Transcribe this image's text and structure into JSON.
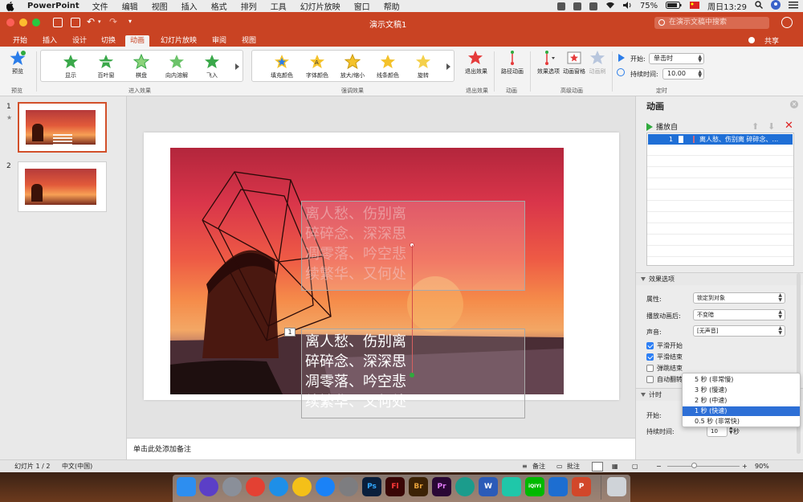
{
  "menubar": {
    "app": "PowerPoint",
    "items": [
      "文件",
      "编辑",
      "视图",
      "插入",
      "格式",
      "排列",
      "工具",
      "幻灯片放映",
      "窗口",
      "帮助"
    ],
    "battery": "75%",
    "clock": "周日13:29"
  },
  "window": {
    "title": "演示文稿1",
    "search_placeholder": "在演示文稿中搜索"
  },
  "ribbon_tabs": {
    "items": [
      "开始",
      "插入",
      "设计",
      "切换",
      "动画",
      "幻灯片放映",
      "审阅",
      "视图"
    ],
    "active": "动画",
    "share": "共享"
  },
  "ribbon": {
    "preview_label": "预览",
    "preview_group": "预览",
    "entrance_group": "进入效果",
    "entrance": [
      "显示",
      "百叶窗",
      "棋盘",
      "向内溶解",
      "飞入"
    ],
    "emphasis_group": "强调效果",
    "emphasis": [
      "填充颜色",
      "字体颜色",
      "放大/缩小",
      "线条颜色",
      "旋转"
    ],
    "exit_label": "退出效果",
    "exit_group": "退出效果",
    "path_label": "路径动画",
    "path_group": "动画",
    "effect_options": "效果选项",
    "anim_pane": "动画窗格",
    "anim_brush": "动画刷",
    "advanced_group": "高级动画",
    "start_label": "开始:",
    "start_value": "单击时",
    "duration_label": "持续时间:",
    "duration_value": "10.00",
    "timing_group": "定时"
  },
  "slides": {
    "numbers": [
      "1",
      "2"
    ],
    "star": "★"
  },
  "slide": {
    "poem": "离人愁、伤别离\n碎碎念、深深思\n凋零落、吟空悲\n续繁华、又何处",
    "anim_badge": "1"
  },
  "notes_placeholder": "单击此处添加备注",
  "pane": {
    "title": "动画",
    "play_from": "播放自",
    "item_number": "1",
    "item_text": "离人愁、伤别离 碎碎念、...",
    "effect_section": "效果选项",
    "property_label": "属性:",
    "property_value": "锁定到对象",
    "after_label": "播放动画后:",
    "after_value": "不变暗",
    "sound_label": "声音:",
    "sound_value": "[无声音]",
    "smooth_start": "平滑开始",
    "smooth_end": "平滑结束",
    "bounce_end": "弹跳结束",
    "auto_reverse": "自动翻转",
    "timing_section": "计时",
    "start_label": "开始:",
    "duration_label": "持续时间:",
    "duration_value": "10",
    "seconds_unit": "秒",
    "checks": {
      "smooth_start": true,
      "smooth_end": true,
      "bounce_end": false,
      "auto_reverse": false
    }
  },
  "speed_dropdown": {
    "options": [
      "5 秒 (非常慢)",
      "3 秒 (慢速)",
      "2 秒 (中速)",
      "1 秒 (快速)",
      "0.5 秒 (非常快)"
    ],
    "selected": "1 秒 (快速)"
  },
  "statusbar": {
    "slide_counter": "幻灯片 1 / 2",
    "language": "中文(中国)",
    "notes": "备注",
    "comments": "批注",
    "zoom": "90%"
  },
  "dock": {
    "apps": [
      "finder",
      "siri",
      "launchpad",
      "chrome",
      "safari",
      "qq",
      "app-store",
      "system-preferences",
      "photoshop",
      "flash",
      "bridge",
      "premiere",
      "edge",
      "word",
      "wps",
      "iqiyi",
      "xcode",
      "powerpoint",
      "trash"
    ],
    "letters": {
      "photoshop": "Ps",
      "flash": "Fl",
      "bridge": "Br",
      "premiere": "Pr",
      "word": "W",
      "iqiyi": "iQIYI",
      "powerpoint": "P"
    }
  },
  "colors": {
    "accent": "#c94323",
    "selection_blue": "#1f6fd6",
    "play_green": "#2faa3d"
  }
}
